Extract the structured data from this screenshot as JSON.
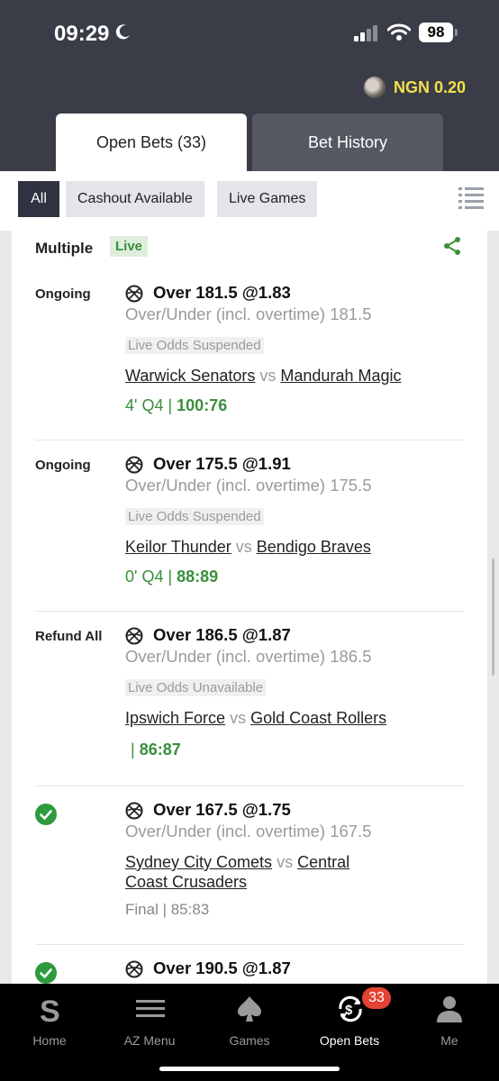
{
  "status": {
    "time": "09:29",
    "battery": "98"
  },
  "header": {
    "balance": "NGN 0.20"
  },
  "tabs": [
    {
      "label": "Open Bets (33)"
    },
    {
      "label": "Bet History"
    }
  ],
  "filters": [
    {
      "label": "All"
    },
    {
      "label": "Cashout Available"
    },
    {
      "label": "Live Games"
    }
  ],
  "card": {
    "title": "Multiple",
    "badge": "Live"
  },
  "legs": [
    {
      "status": "Ongoing",
      "selection": "Over 181.5 @1.83",
      "market": "Over/Under (incl. overtime) 181.5",
      "note": "Live Odds Suspended",
      "home": "Warwick Senators",
      "vs": "vs",
      "away": "Mandurah Magic",
      "time": "4' Q4 |",
      "score": "100:76"
    },
    {
      "status": "Ongoing",
      "selection": "Over 175.5 @1.91",
      "market": "Over/Under (incl. overtime) 175.5",
      "note": "Live Odds Suspended",
      "home": "Keilor Thunder",
      "vs": "vs",
      "away": "Bendigo Braves",
      "time": "0' Q4 |",
      "score": "88:89"
    },
    {
      "status": "Refund All",
      "selection": "Over 186.5 @1.87",
      "market": "Over/Under (incl. overtime) 186.5",
      "note": "Live Odds Unavailable",
      "home": "Ipswich Force",
      "vs": "vs",
      "away": "Gold Coast Rollers",
      "time": "|",
      "score": "86:87"
    },
    {
      "status": "won",
      "selection": "Over 167.5 @1.75",
      "market": "Over/Under (incl. overtime) 167.5",
      "home": "Sydney City Comets",
      "vs": "vs",
      "away": "Central",
      "away2": "Coast Crusaders",
      "final": "Final | 85:83"
    },
    {
      "status": "won",
      "selection": "Over 190.5 @1.87"
    }
  ],
  "nav": [
    {
      "label": "Home",
      "icon": "home-s-icon"
    },
    {
      "label": "AZ Menu",
      "icon": "hamburger-icon"
    },
    {
      "label": "Games",
      "icon": "spade-icon"
    },
    {
      "label": "Open Bets",
      "icon": "open-bets-icon",
      "badge": "33"
    },
    {
      "label": "Me",
      "icon": "person-icon"
    }
  ],
  "colors": {
    "header_bg": "#3a3d47",
    "balance": "#f4e04a",
    "live_green": "#3a8f3a",
    "badge_red": "#e34234"
  }
}
